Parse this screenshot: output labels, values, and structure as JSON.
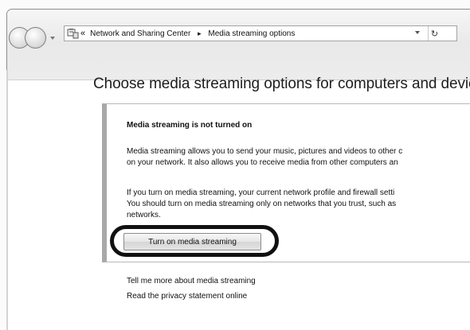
{
  "address_bar": {
    "chevrons": "«",
    "crumb_1": "Network and Sharing Center",
    "crumb_arrow": "▸",
    "crumb_2": "Media streaming options"
  },
  "page": {
    "heading": "Choose media streaming options for computers and devices"
  },
  "panel": {
    "title": "Media streaming is not turned on",
    "paragraph1_line1": "Media streaming allows you to send your music, pictures and videos to other c",
    "paragraph1_line2": "on your network. It also allows you to receive media from other computers an",
    "paragraph2_line1": "If you turn on media streaming, your current network profile and firewall setti",
    "paragraph2_line2": "You should turn on media streaming only on networks that you trust, such as",
    "paragraph2_line3": "networks.",
    "button_label": "Turn on media streaming"
  },
  "links": {
    "more_info": "Tell me more about media streaming",
    "privacy": "Read the privacy statement online"
  }
}
